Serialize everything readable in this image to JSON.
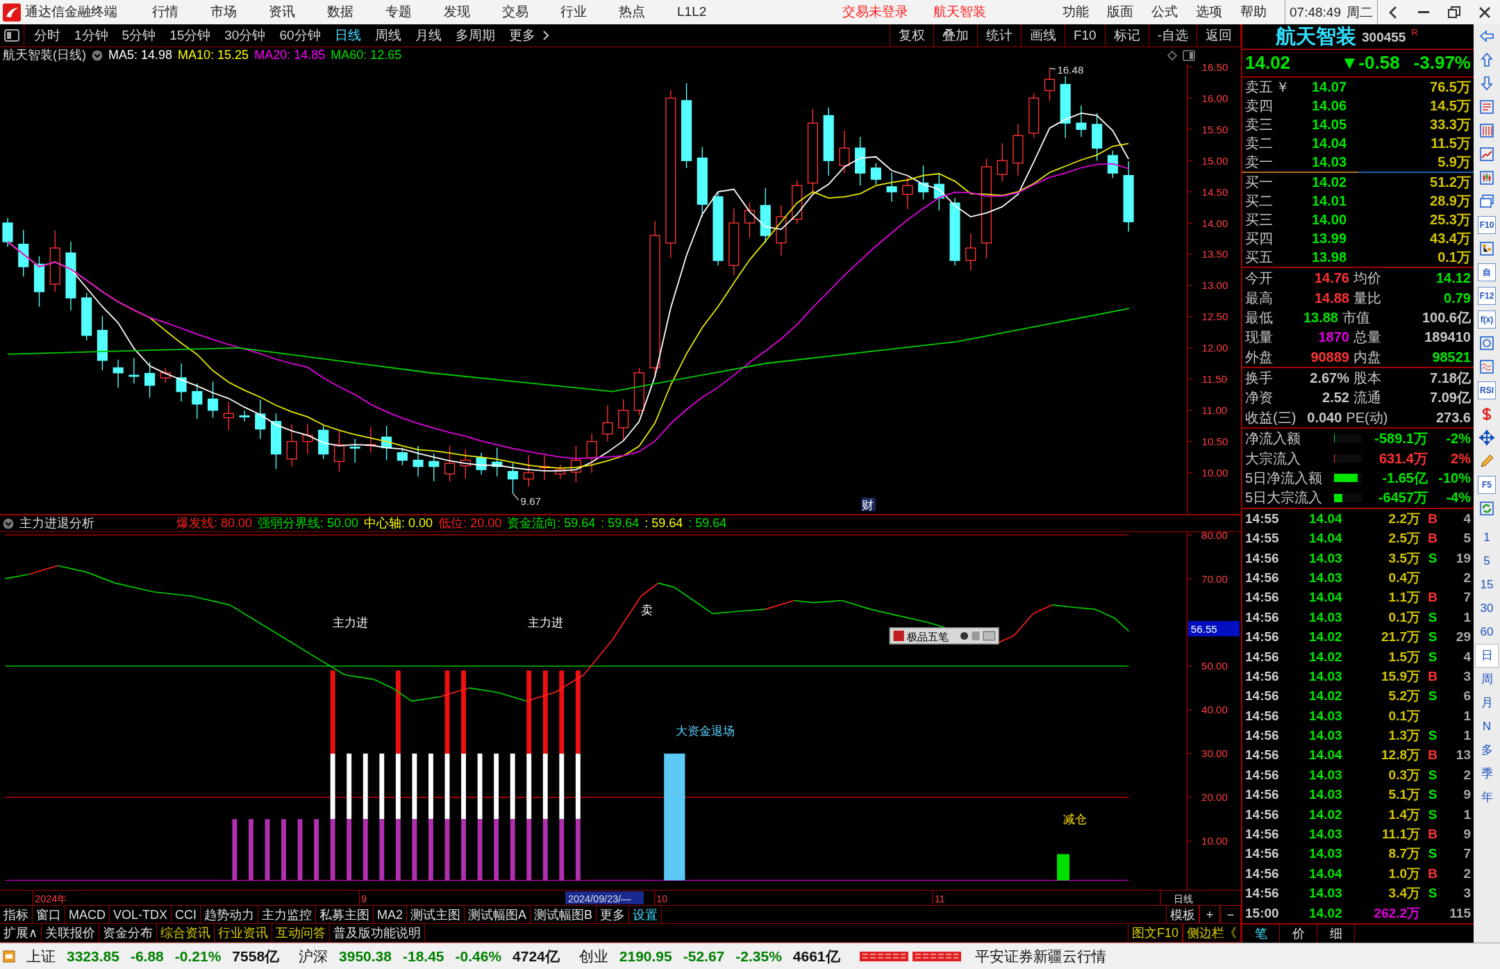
{
  "title_bar": {
    "app_name": "通达信金融终端",
    "menus": [
      "行情",
      "市场",
      "资讯",
      "数据",
      "专题",
      "发现",
      "交易",
      "行业",
      "热点",
      "L1L2"
    ],
    "notices": [
      "交易未登录",
      "航天智装"
    ],
    "right_menus": [
      "功能",
      "版面",
      "公式",
      "选项",
      "帮助"
    ],
    "clock": "07:48:49",
    "weekday": "周二"
  },
  "period_tabs": [
    {
      "label": "分时",
      "selected": false
    },
    {
      "label": "1分钟",
      "selected": false
    },
    {
      "label": "5分钟",
      "selected": false
    },
    {
      "label": "15分钟",
      "selected": false
    },
    {
      "label": "30分钟",
      "selected": false
    },
    {
      "label": "60分钟",
      "selected": false
    },
    {
      "label": "日线",
      "selected": true
    },
    {
      "label": "周线",
      "selected": false
    },
    {
      "label": "月线",
      "selected": false
    },
    {
      "label": "多周期",
      "selected": false
    },
    {
      "label": "更多",
      "selected": false
    }
  ],
  "chart_tools": [
    "复权",
    "叠加",
    "统计",
    "画线",
    "F10",
    "标记",
    "-自选",
    "返回"
  ],
  "chart_header": {
    "title": "航天智装(日线)",
    "ma_legend": [
      {
        "label": "MA5: 14.98",
        "color": "#ffffff"
      },
      {
        "label": "MA10: 15.25",
        "color": "#ffff00"
      },
      {
        "label": "MA20: 14.85",
        "color": "#ff00ff"
      },
      {
        "label": "MA60: 12.65",
        "color": "#00e000"
      }
    ]
  },
  "price_axis": [
    "16.50",
    "16.00",
    "15.50",
    "15.00",
    "14.50",
    "14.00",
    "13.50",
    "13.00",
    "12.50",
    "12.00",
    "11.50",
    "11.00",
    "10.50",
    "10.00"
  ],
  "price_annotations": [
    {
      "kind": "high",
      "label": "16.48"
    },
    {
      "kind": "low",
      "label": "9.67"
    }
  ],
  "news_tag": "财",
  "indicator": {
    "title": "主力进退分析",
    "legend": [
      {
        "label": "爆发线: 80.00",
        "color": "#ff2020"
      },
      {
        "label": "强弱分界线: 50.00",
        "color": "#00e000"
      },
      {
        "label": "中心轴: 0.00",
        "color": "#ffff00"
      },
      {
        "label": "低位: 20.00",
        "color": "#ff2020"
      },
      {
        "label": "资金流向: 59.64",
        "color": "#00e000"
      },
      {
        "label": ": 59.64",
        "color": "#00e000"
      },
      {
        "label": ": 59.64",
        "color": "#ffff00"
      },
      {
        "label": ": 59.64",
        "color": "#00e000"
      }
    ],
    "axis": [
      "80.00",
      "70.00",
      "50.00",
      "40.00",
      "30.00",
      "20.00",
      "10.00"
    ],
    "current_value": "56.55",
    "signals": [
      {
        "kind": "buy",
        "label": "主力进"
      },
      {
        "kind": "buy",
        "label": "主力进"
      },
      {
        "kind": "sell",
        "label": "卖"
      },
      {
        "kind": "exit",
        "label": "大资金退场"
      },
      {
        "kind": "reduce",
        "label": "减仓"
      }
    ],
    "ime_label": "极品五笔"
  },
  "date_axis": {
    "labels": [
      "2024年",
      "9",
      "10",
      "11"
    ],
    "cursor_date": "2024/09/23/—",
    "period": "日线"
  },
  "bottom_tabs": [
    {
      "label": "指标",
      "selected": false
    },
    {
      "label": "窗口",
      "selected": false
    },
    {
      "label": "MACD",
      "selected": false
    },
    {
      "label": "VOL-TDX",
      "selected": false
    },
    {
      "label": "CCI",
      "selected": false
    },
    {
      "label": "趋势动力",
      "selected": false
    },
    {
      "label": "主力监控",
      "selected": false
    },
    {
      "label": "私募主图",
      "selected": false
    },
    {
      "label": "MA2",
      "selected": false
    },
    {
      "label": "测试主图",
      "selected": false
    },
    {
      "label": "测试幅图A",
      "selected": false
    },
    {
      "label": "测试幅图B",
      "selected": false
    },
    {
      "label": "更多",
      "selected": false
    },
    {
      "label": "设置",
      "selected": true
    }
  ],
  "bottom_controls": [
    "模板",
    "+",
    "−"
  ],
  "extension_tabs": [
    {
      "label": "扩展∧",
      "highlight": false
    },
    {
      "label": "关联报价",
      "highlight": false
    },
    {
      "label": "资金分布",
      "highlight": false
    },
    {
      "label": "综合资讯",
      "highlight": true
    },
    {
      "label": "行业资讯",
      "highlight": true
    },
    {
      "label": "互动问答",
      "highlight": true
    },
    {
      "label": "普及版功能说明",
      "highlight": false
    }
  ],
  "side_links": [
    "图文F10",
    "侧边栏《"
  ],
  "quote": {
    "name": "航天智装",
    "code": "300455",
    "badge": "R",
    "last": "14.02",
    "change": "▼-0.58",
    "change_pct": "-3.97%",
    "currency_mark": "￥",
    "asks": [
      {
        "label": "卖五",
        "price": "14.07",
        "volume": "76.5万"
      },
      {
        "label": "卖四",
        "price": "14.06",
        "volume": "14.5万"
      },
      {
        "label": "卖三",
        "price": "14.05",
        "volume": "33.3万"
      },
      {
        "label": "卖二",
        "price": "14.04",
        "volume": "11.5万"
      },
      {
        "label": "卖一",
        "price": "14.03",
        "volume": "5.9万"
      }
    ],
    "bids": [
      {
        "label": "买一",
        "price": "14.02",
        "volume": "51.2万"
      },
      {
        "label": "买二",
        "price": "14.01",
        "volume": "28.9万"
      },
      {
        "label": "买三",
        "price": "14.00",
        "volume": "25.3万"
      },
      {
        "label": "买四",
        "price": "13.99",
        "volume": "43.4万"
      },
      {
        "label": "买五",
        "price": "13.98",
        "volume": "0.1万"
      }
    ],
    "stats": [
      {
        "label": "今开",
        "value": "14.76",
        "color": "#ff3232"
      },
      {
        "label": "均价",
        "value": "14.12",
        "color": "#00e600"
      },
      {
        "label": "最高",
        "value": "14.88",
        "color": "#ff3232"
      },
      {
        "label": "量比",
        "value": "0.79",
        "color": "#00e600"
      },
      {
        "label": "最低",
        "value": "13.88",
        "color": "#00e600"
      },
      {
        "label": "市值",
        "value": "100.6亿",
        "color": "#c8c8c8"
      },
      {
        "label": "现量",
        "value": "1870",
        "color": "#e000e0"
      },
      {
        "label": "总量",
        "value": "189410",
        "color": "#c8c8c8"
      },
      {
        "label": "外盘",
        "value": "90889",
        "color": "#ff3232"
      },
      {
        "label": "内盘",
        "value": "98521",
        "color": "#00e600"
      }
    ],
    "stats2": [
      {
        "label": "换手",
        "value": "2.67%"
      },
      {
        "label": "股本",
        "value": "7.18亿"
      },
      {
        "label": "净资",
        "value": "2.52"
      },
      {
        "label": "流通",
        "value": "7.09亿"
      },
      {
        "label": "收益(三)",
        "value": "0.040"
      },
      {
        "label": "PE(动)",
        "value": "273.6"
      }
    ],
    "flows": [
      {
        "label": "净流入额",
        "value": "-589.1万",
        "pct": "-2%",
        "color": "#00e600",
        "level": 0.02
      },
      {
        "label": "大宗流入",
        "value": "631.4万",
        "pct": "2%",
        "color": "#ff3232",
        "level": 0.02
      },
      {
        "label": "5日净流入额",
        "value": "-1.65亿",
        "pct": "-10%",
        "color": "#00e600",
        "level": 0.85
      },
      {
        "label": "5日大宗流入",
        "value": "-6457万",
        "pct": "-4%",
        "color": "#00e600",
        "level": 0.3
      }
    ],
    "ticks": [
      {
        "time": "14:55",
        "price": "14.04",
        "volume": "2.2万",
        "side": "B",
        "color": "#ff3232",
        "count": "4",
        "large": false
      },
      {
        "time": "14:55",
        "price": "14.04",
        "volume": "2.5万",
        "side": "B",
        "color": "#ff3232",
        "count": "5",
        "large": false
      },
      {
        "time": "14:56",
        "price": "14.03",
        "volume": "3.5万",
        "side": "S",
        "color": "#00e600",
        "count": "19",
        "large": false
      },
      {
        "time": "14:56",
        "price": "14.03",
        "volume": "0.4万",
        "count": "2",
        "large": false
      },
      {
        "time": "14:56",
        "price": "14.04",
        "volume": "1.1万",
        "side": "B",
        "color": "#ff3232",
        "count": "7",
        "large": false
      },
      {
        "time": "14:56",
        "price": "14.03",
        "volume": "0.1万",
        "side": "S",
        "color": "#00e600",
        "count": "1",
        "large": false
      },
      {
        "time": "14:56",
        "price": "14.02",
        "volume": "21.7万",
        "side": "S",
        "color": "#00e600",
        "count": "29",
        "large": false
      },
      {
        "time": "14:56",
        "price": "14.02",
        "volume": "1.5万",
        "side": "S",
        "color": "#00e600",
        "count": "4",
        "large": false
      },
      {
        "time": "14:56",
        "price": "14.03",
        "volume": "15.9万",
        "side": "B",
        "color": "#ff3232",
        "count": "3",
        "large": false
      },
      {
        "time": "14:56",
        "price": "14.02",
        "volume": "5.2万",
        "side": "S",
        "color": "#00e600",
        "count": "6",
        "large": false
      },
      {
        "time": "14:56",
        "price": "14.03",
        "volume": "0.1万",
        "count": "1",
        "large": false
      },
      {
        "time": "14:56",
        "price": "14.03",
        "volume": "1.3万",
        "side": "S",
        "color": "#00e600",
        "count": "1",
        "large": false
      },
      {
        "time": "14:56",
        "price": "14.04",
        "volume": "12.8万",
        "side": "B",
        "color": "#ff3232",
        "count": "13",
        "large": false
      },
      {
        "time": "14:56",
        "price": "14.03",
        "volume": "0.3万",
        "side": "S",
        "color": "#00e600",
        "count": "2",
        "large": false
      },
      {
        "time": "14:56",
        "price": "14.03",
        "volume": "5.1万",
        "side": "S",
        "color": "#00e600",
        "count": "9",
        "large": false
      },
      {
        "time": "14:56",
        "price": "14.02",
        "volume": "1.4万",
        "side": "S",
        "color": "#00e600",
        "count": "1",
        "large": false
      },
      {
        "time": "14:56",
        "price": "14.03",
        "volume": "11.1万",
        "side": "B",
        "color": "#ff3232",
        "count": "9",
        "large": false
      },
      {
        "time": "14:56",
        "price": "14.03",
        "volume": "8.7万",
        "side": "S",
        "color": "#00e600",
        "count": "7",
        "large": false
      },
      {
        "time": "14:56",
        "price": "14.04",
        "volume": "1.0万",
        "side": "B",
        "color": "#ff3232",
        "count": "2",
        "large": false
      },
      {
        "time": "14:56",
        "price": "14.03",
        "volume": "3.4万",
        "side": "S",
        "color": "#00e600",
        "count": "3",
        "large": false
      },
      {
        "time": "15:00",
        "price": "14.02",
        "volume": "262.2万",
        "count": "115",
        "large": true
      }
    ],
    "panel_tabs": [
      "笔",
      "价",
      "细"
    ]
  },
  "sidebar": {
    "tools": [
      {
        "kind": "arrow-left"
      },
      {
        "kind": "arrow-up"
      },
      {
        "kind": "arrow-down"
      },
      {
        "kind": "table"
      },
      {
        "kind": "grid"
      },
      {
        "kind": "line-chart"
      },
      {
        "kind": "candles"
      },
      {
        "kind": "windows"
      },
      {
        "kind": "text",
        "label": "F10"
      },
      {
        "kind": "tree"
      },
      {
        "kind": "text",
        "label": "自"
      },
      {
        "kind": "text",
        "label": "F12"
      },
      {
        "kind": "text",
        "label": "f(x)"
      },
      {
        "kind": "circle"
      },
      {
        "kind": "wave"
      },
      {
        "kind": "text",
        "label": "RSI"
      },
      {
        "kind": "dollar"
      },
      {
        "kind": "move"
      },
      {
        "kind": "pencil"
      },
      {
        "kind": "text",
        "label": "F5"
      },
      {
        "kind": "refresh"
      }
    ],
    "periods": [
      {
        "label": "1",
        "selected": false
      },
      {
        "label": "5",
        "selected": false
      },
      {
        "label": "15",
        "selected": false
      },
      {
        "label": "30",
        "selected": false
      },
      {
        "label": "60",
        "selected": false
      },
      {
        "label": "日",
        "selected": true
      },
      {
        "label": "周",
        "selected": false
      },
      {
        "label": "月",
        "selected": false
      },
      {
        "label": "N",
        "selected": false
      },
      {
        "label": "多",
        "selected": false
      },
      {
        "label": "季",
        "selected": false
      },
      {
        "label": "年",
        "selected": false
      }
    ]
  },
  "status_bar": {
    "indexes": [
      {
        "name": "上证",
        "value": "3323.85",
        "change": "-6.88",
        "pct": "-0.21%",
        "amount": "7558亿"
      },
      {
        "name": "沪深",
        "value": "3950.38",
        "change": "-18.45",
        "pct": "-0.46%",
        "amount": "4724亿"
      },
      {
        "name": "创业",
        "value": "2190.95",
        "change": "-52.67",
        "pct": "-2.35%",
        "amount": "4661亿"
      }
    ],
    "broker": "平安证券新疆云行情"
  }
}
